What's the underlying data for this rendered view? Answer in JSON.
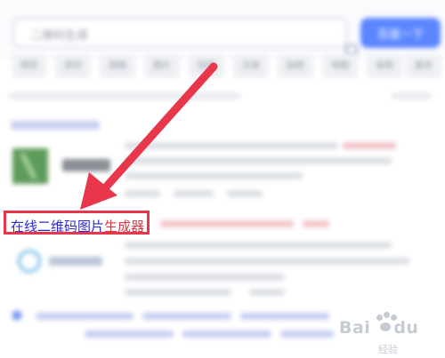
{
  "search": {
    "query": "二维码生成",
    "button_label": "百度一下"
  },
  "tabs": [
    "网页",
    "资讯",
    "视频",
    "图片",
    "知道",
    "文库",
    "贴吧",
    "地图",
    "采购",
    "更多"
  ],
  "result": {
    "title_prefix": "在线",
    "title_highlight": "二维码",
    "title_suffix": "图片",
    "title_highlight2": "生成",
    "title_end": "器"
  },
  "watermark": {
    "brand": "Bai",
    "brand_paw": "du",
    "sub": "经验"
  },
  "colors": {
    "annotation_red": "#e8364b",
    "link_blue": "#2b2bd1",
    "keyword_red": "#d93a4a",
    "search_button": "#5b86ff"
  }
}
